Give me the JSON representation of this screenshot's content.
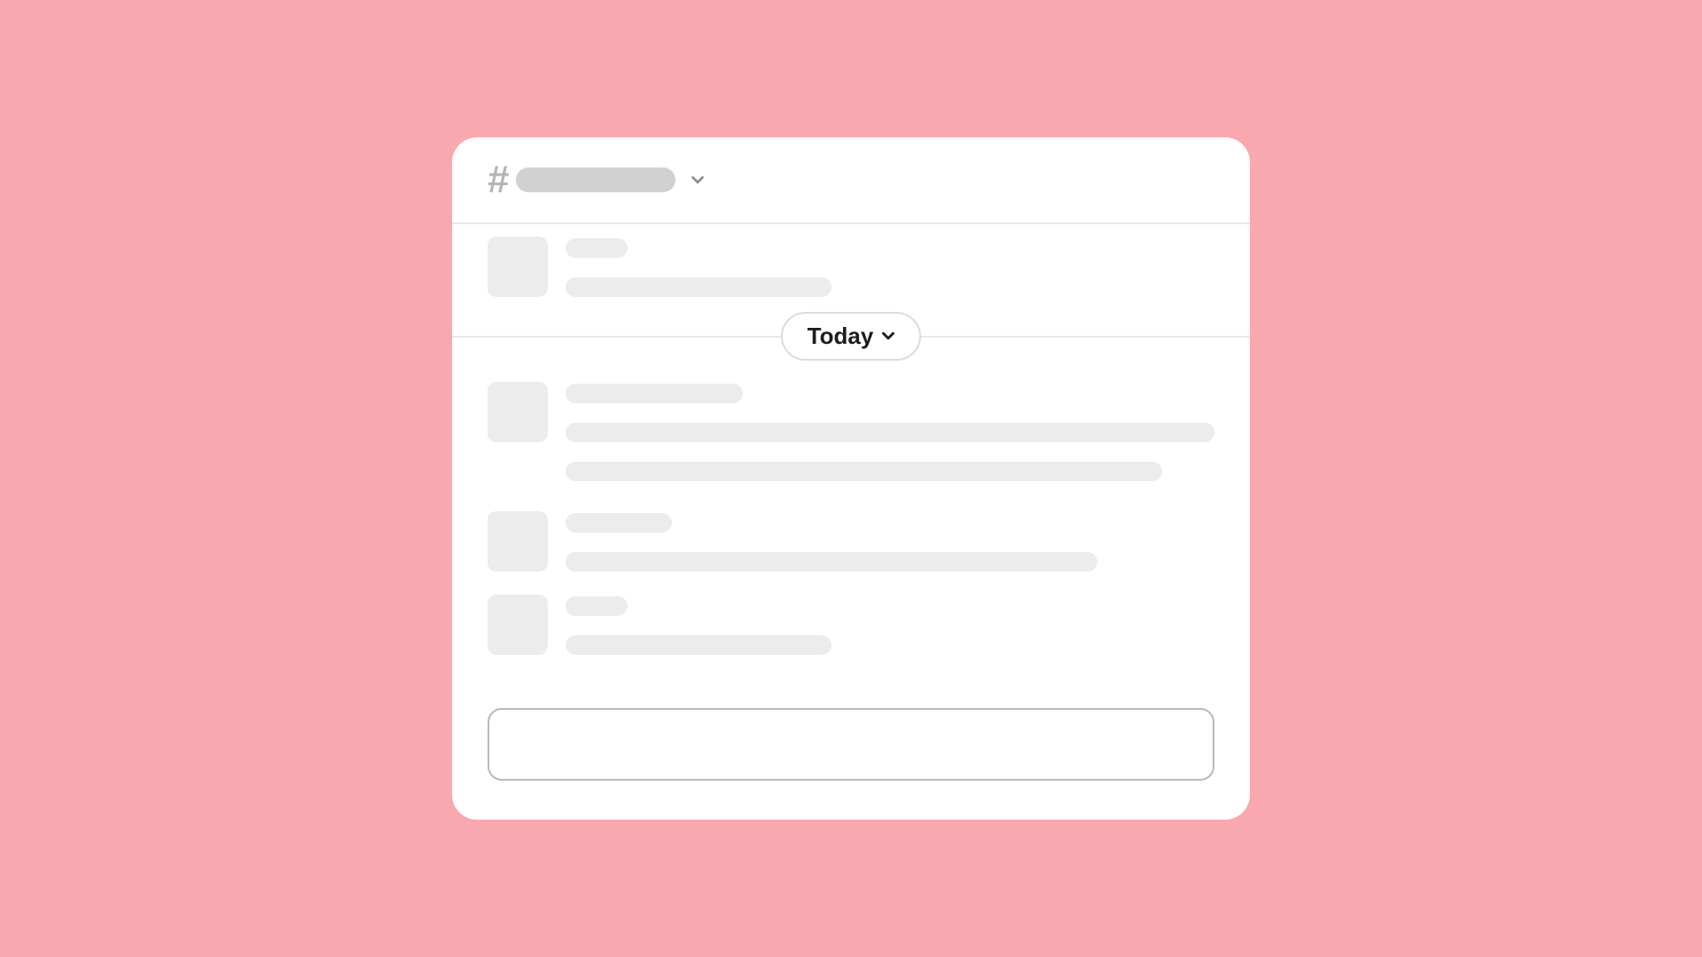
{
  "divider": {
    "label": "Today"
  },
  "composer": {
    "value": "",
    "placeholder": ""
  }
}
